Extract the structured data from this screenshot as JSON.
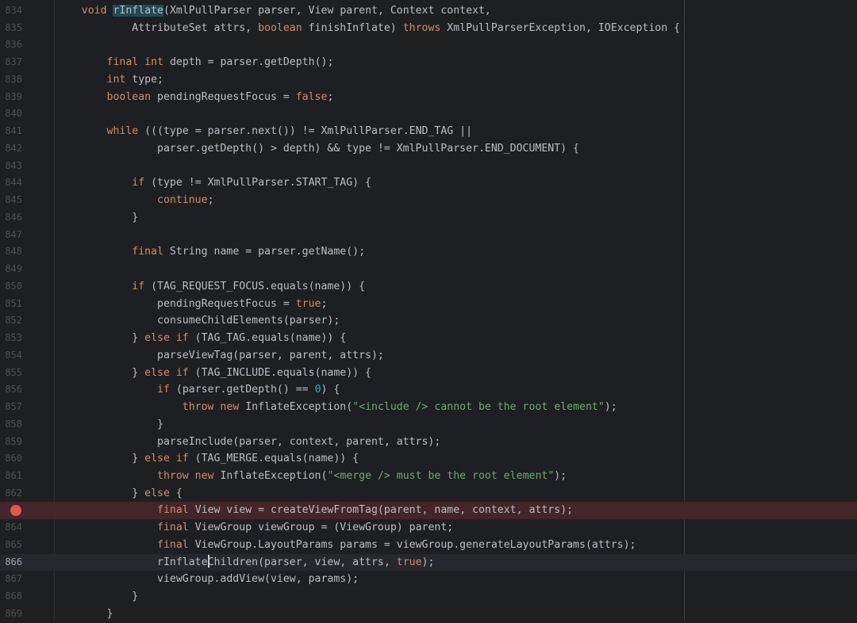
{
  "editor": {
    "current_line": 866,
    "breakpoint_line": 863,
    "lines": [
      {
        "num": "834",
        "code": [
          {
            "t": "    "
          },
          {
            "t": "void",
            "c": "kw"
          },
          {
            "t": " "
          },
          {
            "t": "rInflate",
            "c": "hl"
          },
          {
            "t": "(XmlPullParser parser, View parent, Context context,"
          }
        ]
      },
      {
        "num": "835",
        "code": [
          {
            "t": "            AttributeSet attrs, "
          },
          {
            "t": "boolean",
            "c": "kw"
          },
          {
            "t": " finishInflate) "
          },
          {
            "t": "throws",
            "c": "kw"
          },
          {
            "t": " XmlPullParserException, IOException {"
          }
        ]
      },
      {
        "num": "836",
        "code": []
      },
      {
        "num": "837",
        "code": [
          {
            "t": "        "
          },
          {
            "t": "final",
            "c": "kw"
          },
          {
            "t": " "
          },
          {
            "t": "int",
            "c": "kw"
          },
          {
            "t": " depth = parser.getDepth();"
          }
        ]
      },
      {
        "num": "838",
        "code": [
          {
            "t": "        "
          },
          {
            "t": "int",
            "c": "kw"
          },
          {
            "t": " type;"
          }
        ]
      },
      {
        "num": "839",
        "code": [
          {
            "t": "        "
          },
          {
            "t": "boolean",
            "c": "kw"
          },
          {
            "t": " pendingRequestFocus = "
          },
          {
            "t": "false",
            "c": "kw"
          },
          {
            "t": ";"
          }
        ]
      },
      {
        "num": "840",
        "code": []
      },
      {
        "num": "841",
        "code": [
          {
            "t": "        "
          },
          {
            "t": "while",
            "c": "kw"
          },
          {
            "t": " (((type = parser.next()) != XmlPullParser.END_TAG ||"
          }
        ]
      },
      {
        "num": "842",
        "code": [
          {
            "t": "                parser.getDepth() > depth) && type != XmlPullParser.END_DOCUMENT) {"
          }
        ]
      },
      {
        "num": "843",
        "code": []
      },
      {
        "num": "844",
        "code": [
          {
            "t": "            "
          },
          {
            "t": "if",
            "c": "kw"
          },
          {
            "t": " (type != XmlPullParser.START_TAG) {"
          }
        ]
      },
      {
        "num": "845",
        "code": [
          {
            "t": "                "
          },
          {
            "t": "continue",
            "c": "kw"
          },
          {
            "t": ";"
          }
        ]
      },
      {
        "num": "846",
        "code": [
          {
            "t": "            }"
          }
        ]
      },
      {
        "num": "847",
        "code": []
      },
      {
        "num": "848",
        "code": [
          {
            "t": "            "
          },
          {
            "t": "final",
            "c": "kw"
          },
          {
            "t": " String name = parser.getName();"
          }
        ]
      },
      {
        "num": "849",
        "code": []
      },
      {
        "num": "850",
        "code": [
          {
            "t": "            "
          },
          {
            "t": "if",
            "c": "kw"
          },
          {
            "t": " (TAG_REQUEST_FOCUS.equals(name)) {"
          }
        ]
      },
      {
        "num": "851",
        "code": [
          {
            "t": "                pendingRequestFocus = "
          },
          {
            "t": "true",
            "c": "kw"
          },
          {
            "t": ";"
          }
        ]
      },
      {
        "num": "852",
        "code": [
          {
            "t": "                consumeChildElements(parser);"
          }
        ]
      },
      {
        "num": "853",
        "code": [
          {
            "t": "            } "
          },
          {
            "t": "else if",
            "c": "kw"
          },
          {
            "t": " (TAG_TAG.equals(name)) {"
          }
        ]
      },
      {
        "num": "854",
        "code": [
          {
            "t": "                parseViewTag(parser, parent, attrs);"
          }
        ]
      },
      {
        "num": "855",
        "code": [
          {
            "t": "            } "
          },
          {
            "t": "else if",
            "c": "kw"
          },
          {
            "t": " (TAG_INCLUDE.equals(name)) {"
          }
        ]
      },
      {
        "num": "856",
        "code": [
          {
            "t": "                "
          },
          {
            "t": "if",
            "c": "kw"
          },
          {
            "t": " (parser.getDepth() == "
          },
          {
            "t": "0",
            "c": "num"
          },
          {
            "t": ") {"
          }
        ]
      },
      {
        "num": "857",
        "code": [
          {
            "t": "                    "
          },
          {
            "t": "throw new",
            "c": "kw"
          },
          {
            "t": " InflateException("
          },
          {
            "t": "\"<include /> cannot be the root element\"",
            "c": "str"
          },
          {
            "t": ");"
          }
        ]
      },
      {
        "num": "858",
        "code": [
          {
            "t": "                }"
          }
        ]
      },
      {
        "num": "859",
        "code": [
          {
            "t": "                parseInclude(parser, context, parent, attrs);"
          }
        ]
      },
      {
        "num": "860",
        "code": [
          {
            "t": "            } "
          },
          {
            "t": "else if",
            "c": "kw"
          },
          {
            "t": " (TAG_MERGE.equals(name)) {"
          }
        ]
      },
      {
        "num": "861",
        "code": [
          {
            "t": "                "
          },
          {
            "t": "throw new",
            "c": "kw"
          },
          {
            "t": " InflateException("
          },
          {
            "t": "\"<merge /> must be the root element\"",
            "c": "str"
          },
          {
            "t": ");"
          }
        ]
      },
      {
        "num": "862",
        "code": [
          {
            "t": "            } "
          },
          {
            "t": "else",
            "c": "kw"
          },
          {
            "t": " {"
          }
        ]
      },
      {
        "num": "863",
        "code": [
          {
            "t": "                "
          },
          {
            "t": "final",
            "c": "kw"
          },
          {
            "t": " View view = createViewFromTag(parent, name, context, attrs);"
          }
        ]
      },
      {
        "num": "864",
        "code": [
          {
            "t": "                "
          },
          {
            "t": "final",
            "c": "kw"
          },
          {
            "t": " ViewGroup viewGroup = (ViewGroup) parent;"
          }
        ]
      },
      {
        "num": "865",
        "code": [
          {
            "t": "                "
          },
          {
            "t": "final",
            "c": "kw"
          },
          {
            "t": " ViewGroup.LayoutParams params = viewGroup.generateLayoutParams(attrs);"
          }
        ]
      },
      {
        "num": "866",
        "code": [
          {
            "t": "                rInflate"
          },
          {
            "caret": true
          },
          {
            "t": "Children(parser, view, attrs, "
          },
          {
            "t": "true",
            "c": "kw"
          },
          {
            "t": ");"
          }
        ]
      },
      {
        "num": "867",
        "code": [
          {
            "t": "                viewGroup.addView(view, params);"
          }
        ]
      },
      {
        "num": "868",
        "code": [
          {
            "t": "            }"
          }
        ]
      },
      {
        "num": "869",
        "code": [
          {
            "t": "        }"
          }
        ]
      }
    ]
  },
  "colors": {
    "background": "#1e1f22",
    "keyword": "#cf8e6d",
    "string": "#6aab73",
    "number": "#2aacb8",
    "breakpoint": "#e05555",
    "breakpoint_line_bg": "#43252a"
  },
  "icons": {
    "breakpoint": "breakpoint-dot-icon"
  }
}
